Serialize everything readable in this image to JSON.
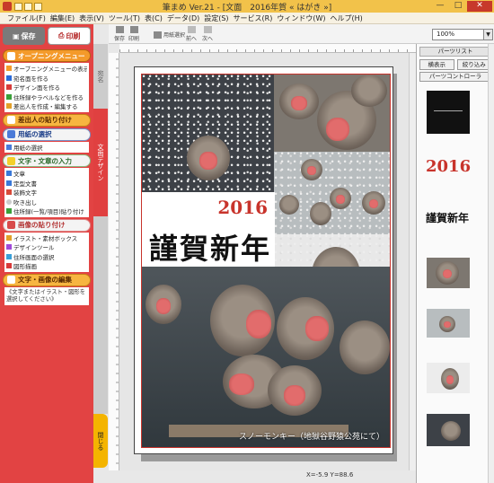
{
  "window": {
    "title": "筆まめ Ver.21 - [文面　2016年賀 « はがき »]",
    "minimize": "—",
    "maximize": "□",
    "close": "✕"
  },
  "menu": [
    "ファイル(F)",
    "編集(E)",
    "表示(V)",
    "ツール(T)",
    "表(C)",
    "データ(D)",
    "設定(S)",
    "サービス(R)",
    "ウィンドウ(W)",
    "ヘルプ(H)"
  ],
  "left_panel": {
    "save_label": "保存",
    "print_label": "印刷",
    "opening_menu": {
      "header": "オープニングメニュー",
      "items": [
        "オープニングメニューの表示",
        "宛名面を作る",
        "デザイン面を作る",
        "住所録やラベルなどを作る",
        "差出人を作成・編集する"
      ]
    },
    "sender_paste": "差出人の貼り付け",
    "paper_select": {
      "header": "用紙の選択",
      "items": [
        "用紙の選択"
      ]
    },
    "text_input": {
      "header": "文字・文章の入力",
      "items": [
        "文章",
        "定型文書",
        "装飾文字",
        "吹き出し",
        "住所録(一覧/項目)貼り付け"
      ]
    },
    "image_paste": {
      "header": "画像の貼り付け",
      "items": [
        "イラスト・素材ボックス",
        "デザインツール",
        "住所画面の選択",
        "図形描画"
      ]
    },
    "edit": {
      "header": "文字・画像の編集",
      "note": "《文字またはイラスト・図形を選択してください》"
    }
  },
  "vertical_tabs": {
    "address": "宛名",
    "design": "文面デザイン",
    "close": "閉じる"
  },
  "toolbar": {
    "save": "保存",
    "print": "印刷",
    "paper_select": "用紙選択",
    "prev": "前へ",
    "next": "次へ",
    "zoom": "100%"
  },
  "card": {
    "year": "2016",
    "greeting": "謹賀新年",
    "caption": "スノーモンキー（地獄谷野猿公苑にて）"
  },
  "status": {
    "coords": "X=-5.9 Y=88.6"
  },
  "right_panel": {
    "header": "パーツリスト",
    "btn_show_all": "横表示",
    "btn_narrow": "絞り込み",
    "btn_controller": "パーツコントローラ",
    "thumb_year": "2016",
    "thumb_greeting": "謹賀新年"
  },
  "colors": {
    "accent_red": "#e24343",
    "title_orange": "#f2c24a",
    "year_red": "#c8342c"
  }
}
